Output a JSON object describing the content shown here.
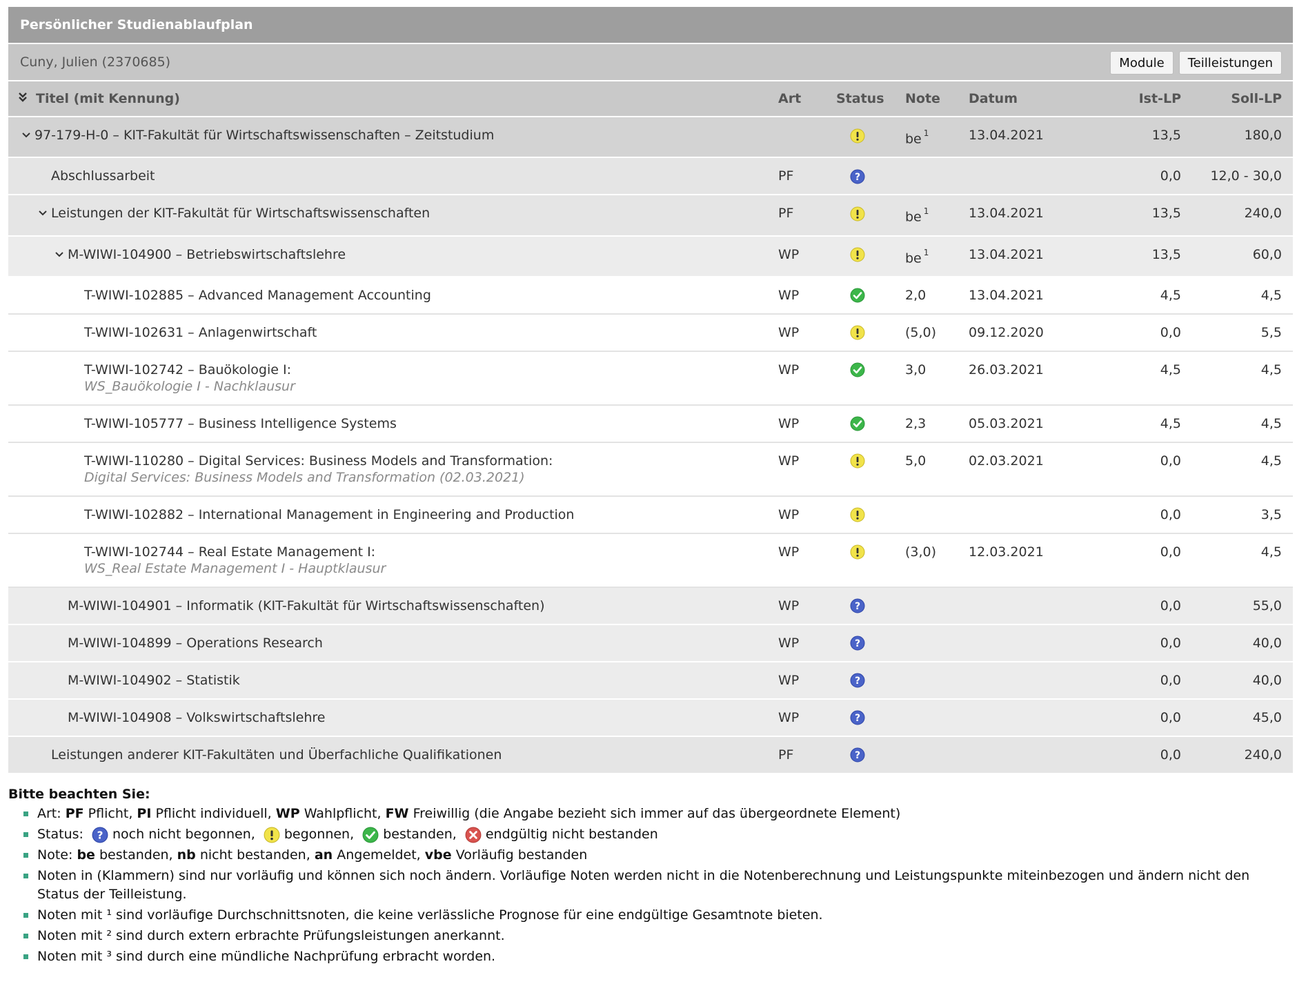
{
  "header": {
    "title": "Persönlicher Studienablaufplan",
    "user": "Cuny, Julien (2370685)",
    "btn_module": "Module",
    "btn_teil": "Teilleistungen"
  },
  "columns": {
    "title": "Titel (mit Kennung)",
    "art": "Art",
    "status": "Status",
    "note": "Note",
    "datum": "Datum",
    "ist": "Ist-LP",
    "soll": "Soll-LP"
  },
  "rows": [
    {
      "title": "97-179-H-0 – KIT-Fakultät für Wirtschaftswissenschaften – Zeitstudium",
      "sub": "",
      "art": "",
      "status": "begonnen",
      "note": "be",
      "sup": "1",
      "datum": "13.04.2021",
      "ist": "13,5",
      "soll": "180,0"
    },
    {
      "title": "Abschlussarbeit",
      "sub": "",
      "art": "PF",
      "status": "nicht-begonnen",
      "note": "",
      "sup": "",
      "datum": "",
      "ist": "0,0",
      "soll": "12,0 - 30,0"
    },
    {
      "title": "Leistungen der KIT-Fakultät für Wirtschaftswissenschaften",
      "sub": "",
      "art": "PF",
      "status": "begonnen",
      "note": "be",
      "sup": "1",
      "datum": "13.04.2021",
      "ist": "13,5",
      "soll": "240,0"
    },
    {
      "title": "M-WIWI-104900 – Betriebswirtschaftslehre",
      "sub": "",
      "art": "WP",
      "status": "begonnen",
      "note": "be",
      "sup": "1",
      "datum": "13.04.2021",
      "ist": "13,5",
      "soll": "60,0"
    },
    {
      "title": "T-WIWI-102885 – Advanced Management Accounting",
      "sub": "",
      "art": "WP",
      "status": "bestanden",
      "note": "2,0",
      "sup": "",
      "datum": "13.04.2021",
      "ist": "4,5",
      "soll": "4,5"
    },
    {
      "title": "T-WIWI-102631 – Anlagenwirtschaft",
      "sub": "",
      "art": "WP",
      "status": "begonnen",
      "note": "(5,0)",
      "sup": "",
      "datum": "09.12.2020",
      "ist": "0,0",
      "soll": "5,5"
    },
    {
      "title": "T-WIWI-102742 – Bauökologie I:",
      "sub": "WS_Bauökologie I - Nachklausur",
      "art": "WP",
      "status": "bestanden",
      "note": "3,0",
      "sup": "",
      "datum": "26.03.2021",
      "ist": "4,5",
      "soll": "4,5"
    },
    {
      "title": "T-WIWI-105777 – Business Intelligence Systems",
      "sub": "",
      "art": "WP",
      "status": "bestanden",
      "note": "2,3",
      "sup": "",
      "datum": "05.03.2021",
      "ist": "4,5",
      "soll": "4,5"
    },
    {
      "title": "T-WIWI-110280 – Digital Services: Business Models and Transformation:",
      "sub": "Digital Services: Business Models and Transformation (02.03.2021)",
      "art": "WP",
      "status": "begonnen",
      "note": "5,0",
      "sup": "",
      "datum": "02.03.2021",
      "ist": "0,0",
      "soll": "4,5"
    },
    {
      "title": "T-WIWI-102882 – International Management in Engineering and Production",
      "sub": "",
      "art": "WP",
      "status": "begonnen",
      "note": "",
      "sup": "",
      "datum": "",
      "ist": "0,0",
      "soll": "3,5"
    },
    {
      "title": "T-WIWI-102744 – Real Estate Management I:",
      "sub": "WS_Real Estate Management I - Hauptklausur",
      "art": "WP",
      "status": "begonnen",
      "note": "(3,0)",
      "sup": "",
      "datum": "12.03.2021",
      "ist": "0,0",
      "soll": "4,5"
    },
    {
      "title": "M-WIWI-104901 – Informatik (KIT-Fakultät für Wirtschaftswissenschaften)",
      "sub": "",
      "art": "WP",
      "status": "nicht-begonnen",
      "note": "",
      "sup": "",
      "datum": "",
      "ist": "0,0",
      "soll": "55,0"
    },
    {
      "title": "M-WIWI-104899 – Operations Research",
      "sub": "",
      "art": "WP",
      "status": "nicht-begonnen",
      "note": "",
      "sup": "",
      "datum": "",
      "ist": "0,0",
      "soll": "40,0"
    },
    {
      "title": "M-WIWI-104902 – Statistik",
      "sub": "",
      "art": "WP",
      "status": "nicht-begonnen",
      "note": "",
      "sup": "",
      "datum": "",
      "ist": "0,0",
      "soll": "40,0"
    },
    {
      "title": "M-WIWI-104908 – Volkswirtschaftslehre",
      "sub": "",
      "art": "WP",
      "status": "nicht-begonnen",
      "note": "",
      "sup": "",
      "datum": "",
      "ist": "0,0",
      "soll": "45,0"
    },
    {
      "title": "Leistungen anderer KIT-Fakultäten und Überfachliche Qualifikationen",
      "sub": "",
      "art": "PF",
      "status": "nicht-begonnen",
      "note": "",
      "sup": "",
      "datum": "",
      "ist": "0,0",
      "soll": "240,0"
    }
  ],
  "legend": {
    "heading": "Bitte beachten Sie:",
    "art_prefix": "Art:",
    "art_pf": "PF",
    "art_pf_t": "Pflicht,",
    "art_pi": "PI",
    "art_pi_t": "Pflicht individuell,",
    "art_wp": "WP",
    "art_wp_t": "Wahlpflicht,",
    "art_fw": "FW",
    "art_fw_t": "Freiwillig (die Angabe bezieht sich immer auf das übergeordnete Element)",
    "status_prefix": "Status:",
    "status_q": "noch nicht begonnen,",
    "status_w": "begonnen,",
    "status_ok": "bestanden,",
    "status_x": "endgültig nicht bestanden",
    "note_prefix": "Note:",
    "note_be": "be",
    "note_be_t": "bestanden,",
    "note_nb": "nb",
    "note_nb_t": "nicht bestanden,",
    "note_an": "an",
    "note_an_t": "Angemeldet,",
    "note_vbe": "vbe",
    "note_vbe_t": "Vorläufig bestanden",
    "klammern": "Noten in (Klammern) sind nur vorläufig und können sich noch ändern. Vorläufige Noten werden nicht in die Notenberechnung und Leistungspunkte miteinbezogen und ändern nicht den Status der Teilleistung.",
    "sup1": "Noten mit ¹ sind vorläufige Durchschnittsnoten, die keine verlässliche Prognose für eine endgültige Gesamtnote bieten.",
    "sup2": "Noten mit ² sind durch extern erbrachte Prüfungsleistungen anerkannt.",
    "sup3": "Noten mit ³ sind durch eine mündliche Nachprüfung erbracht worden."
  },
  "colors": {
    "question": "#4a63c8",
    "warning": "#f1e34a",
    "success": "#3cb64a",
    "fail": "#d9534f"
  }
}
